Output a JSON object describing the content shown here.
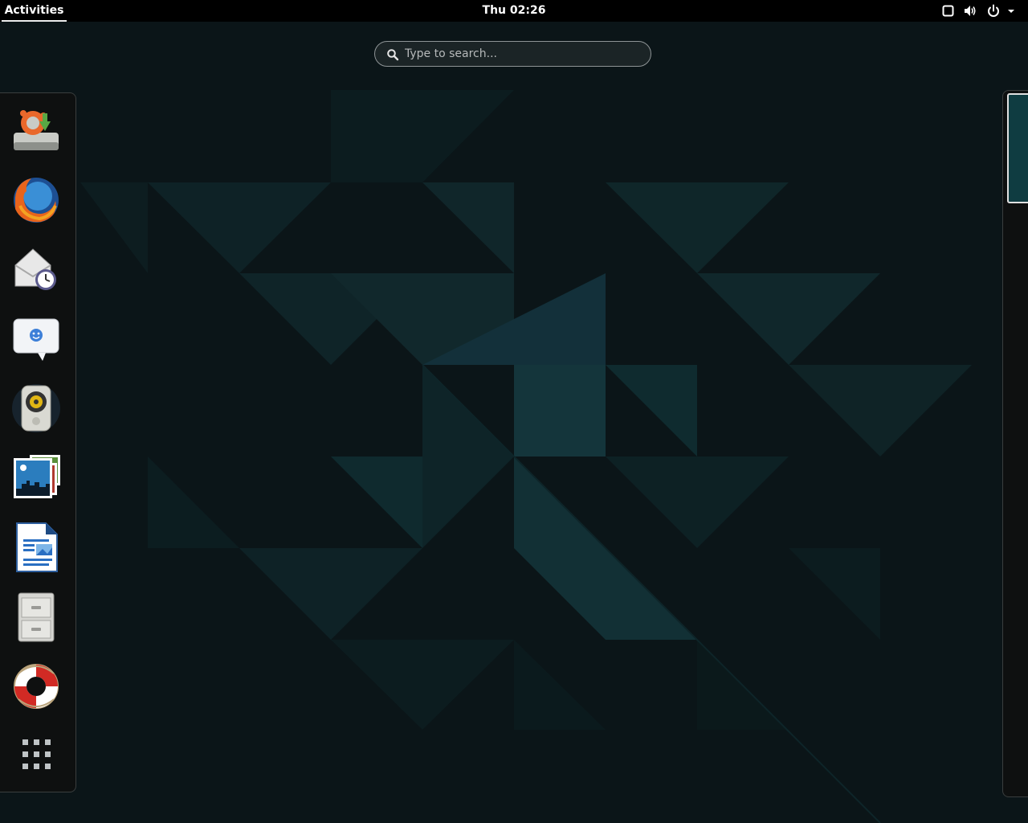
{
  "topbar": {
    "activities_label": "Activities",
    "clock": "Thu 02:26",
    "tray_icons": [
      "screen-icon",
      "volume-icon",
      "power-icon",
      "dropdown-arrow-icon"
    ]
  },
  "search": {
    "placeholder": "Type to search..."
  },
  "dash": {
    "items": [
      {
        "name": "software-updater",
        "icon": "software-updater-icon"
      },
      {
        "name": "firefox",
        "icon": "firefox-icon"
      },
      {
        "name": "evolution-mail",
        "icon": "mail-clock-icon"
      },
      {
        "name": "empathy-chat",
        "icon": "chat-bubble-icon"
      },
      {
        "name": "rhythmbox",
        "icon": "speaker-icon"
      },
      {
        "name": "shotwell",
        "icon": "photos-icon"
      },
      {
        "name": "libreoffice-writer",
        "icon": "document-icon"
      },
      {
        "name": "files",
        "icon": "file-cabinet-icon"
      },
      {
        "name": "help",
        "icon": "lifebuoy-icon"
      },
      {
        "name": "show-applications",
        "icon": "app-grid-icon"
      }
    ]
  },
  "colors": {
    "background": "#0b1518",
    "panel": "#000000",
    "accent": "#0f3c41"
  }
}
